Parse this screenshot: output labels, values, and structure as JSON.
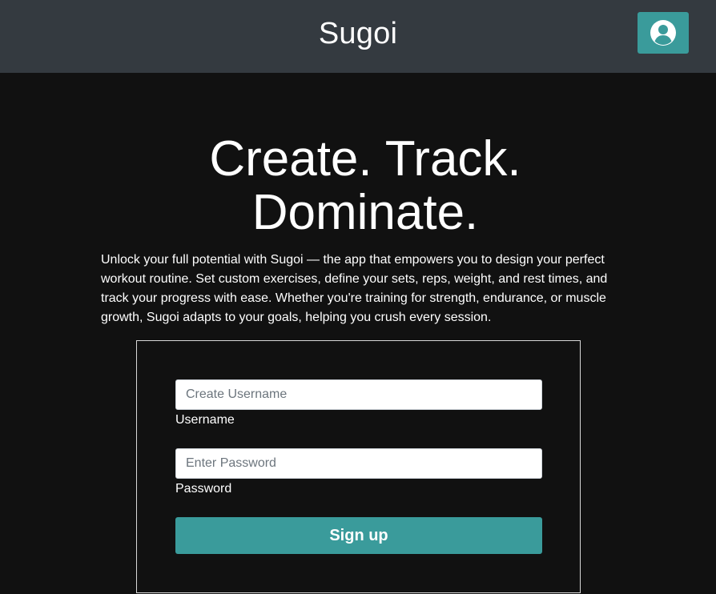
{
  "header": {
    "brand": "Sugoi",
    "profile_icon": "user-circle-icon"
  },
  "hero": {
    "title_line1": "Create. Track.",
    "title_line2": "Dominate.",
    "intro": "Unlock your full potential with Sugoi — the app that empowers you to design your perfect workout routine. Set custom exercises, define your sets, reps, weight, and rest times, and track your progress with ease. Whether you're training for strength, endurance, or muscle growth, Sugoi adapts to your goals, helping you crush every session."
  },
  "form": {
    "username": {
      "value": "",
      "placeholder": "Create Username",
      "label": "Username"
    },
    "password": {
      "value": "",
      "placeholder": "Enter Password",
      "label": "Password"
    },
    "submit_label": "Sign up"
  },
  "colors": {
    "header_bg": "#343a40",
    "page_bg": "#111111",
    "accent": "#3a9b9b"
  }
}
